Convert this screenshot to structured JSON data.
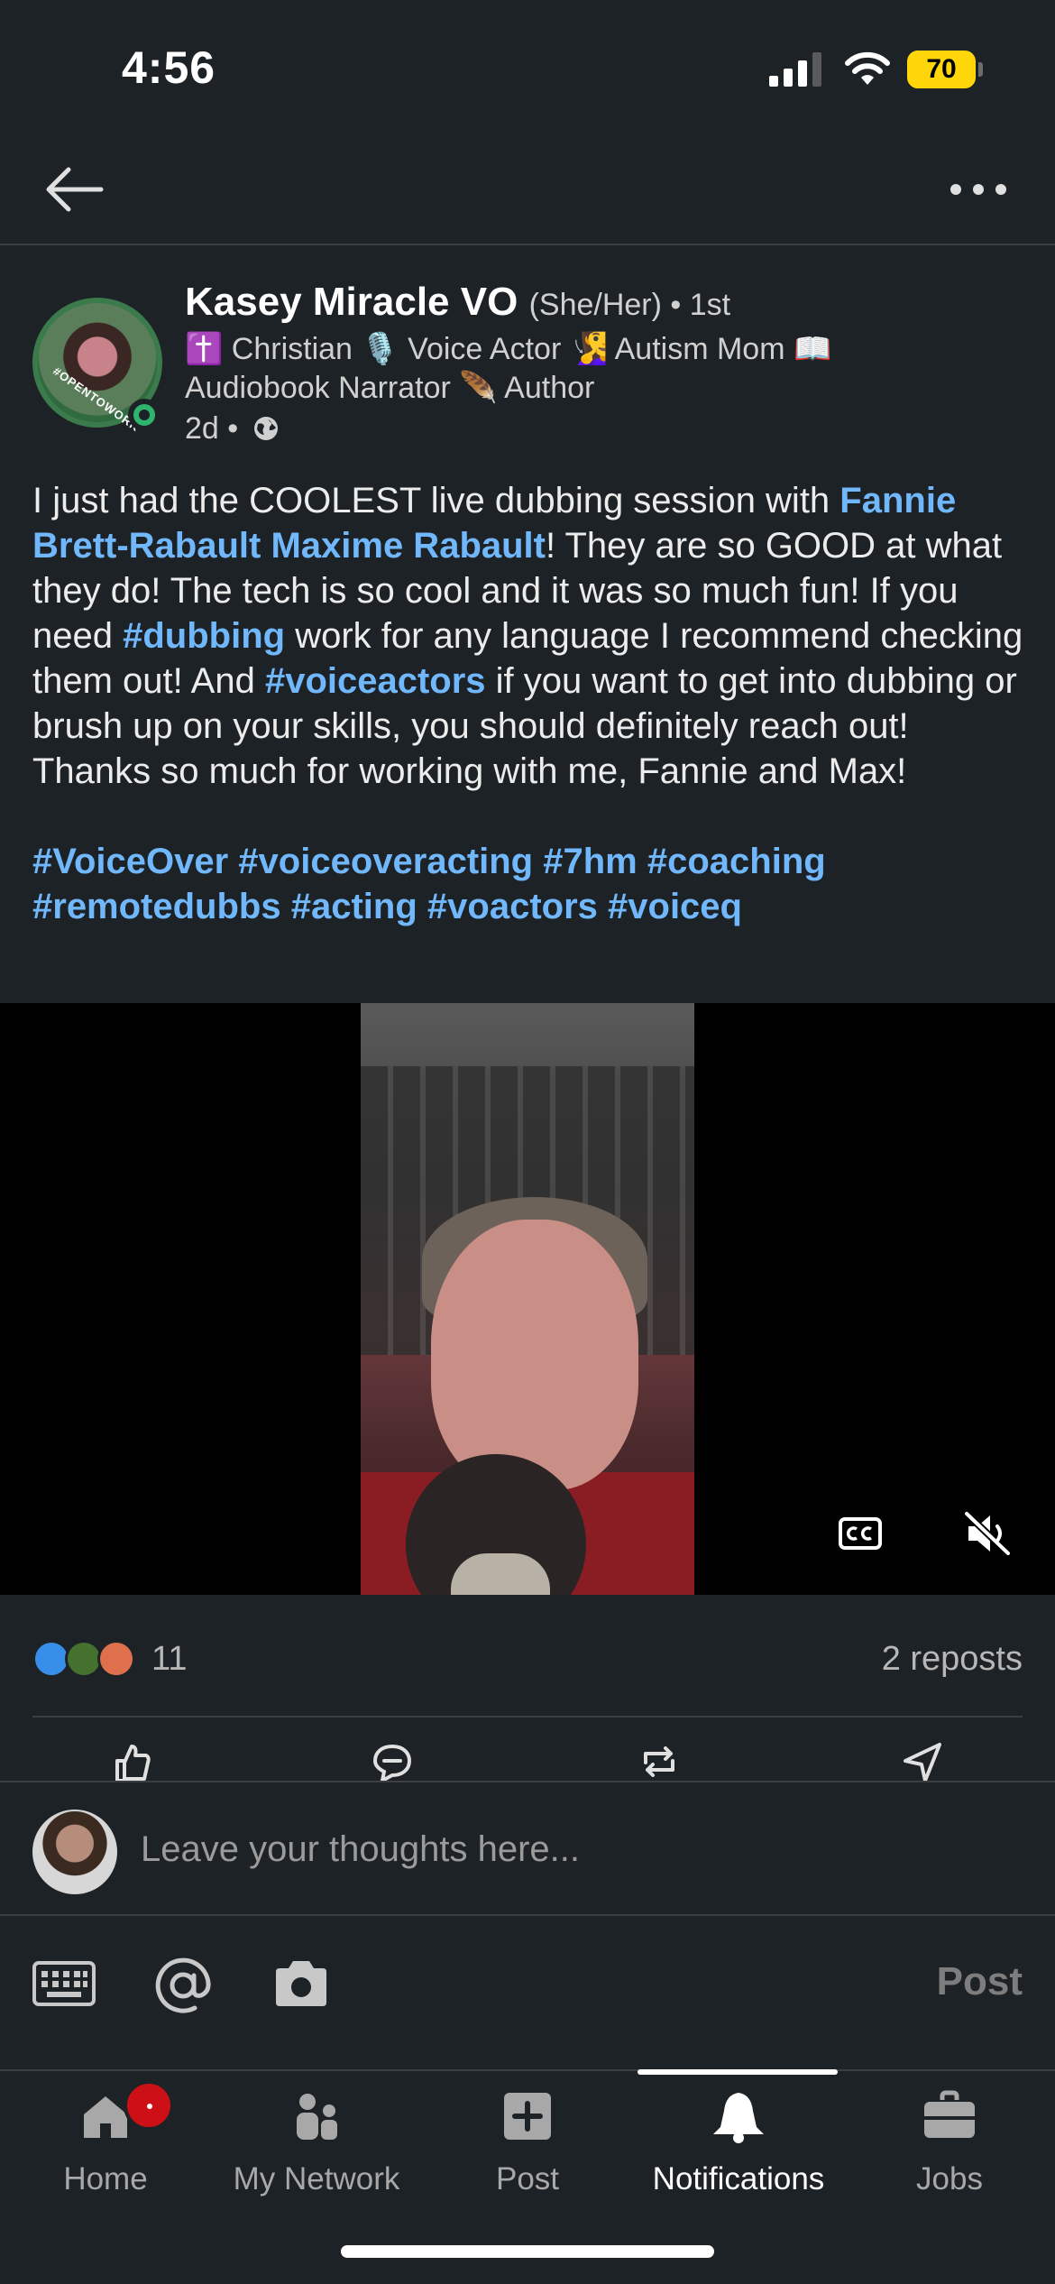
{
  "status_bar": {
    "time": "4:56",
    "battery": "70"
  },
  "post": {
    "author_name": "Kasey Miracle VO",
    "pronouns": "(She/Her)",
    "degree": " • 1st",
    "headline": "✝️ Christian 🎙️ Voice Actor 🧏‍♀️ Autism Mom 📖 Audiobook Narrator 🪶 Author",
    "avatar_frame_text": "#OPENTOWORK",
    "time_ago": "2d •",
    "body": {
      "p1": "I just had the COOLEST live dubbing session with ",
      "mention": "Fannie Brett-Rabault Maxime Rabault",
      "p2": "! They are so GOOD at what they do! The tech is so cool and it was so much fun! If you need ",
      "tag1": "#dubbing",
      "p3": " work for any language I recommend checking them out! And ",
      "tag2": "#voiceactors",
      "p4": " if you want to get into dubbing or brush up on your skills, you should definitely reach out! Thanks so much for working with me, Fannie and Max!"
    },
    "hashtags": [
      "#VoiceOver",
      "#voiceoveracting",
      "#7hm",
      "#coaching",
      "#remotedubbs",
      "#acting",
      "#voactors",
      "#voiceq"
    ],
    "reaction_count": "11",
    "reposts": "2 reposts",
    "reaction_icons": [
      "like-icon",
      "celebrate-icon",
      "love-icon"
    ]
  },
  "comment": {
    "placeholder": "Leave your thoughts here...",
    "post_label": "Post"
  },
  "tabs": [
    {
      "label": "Home",
      "icon": "home-icon"
    },
    {
      "label": "My Network",
      "icon": "network-icon"
    },
    {
      "label": "Post",
      "icon": "plus-icon"
    },
    {
      "label": "Notifications",
      "icon": "bell-icon"
    },
    {
      "label": "Jobs",
      "icon": "briefcase-icon"
    }
  ],
  "colors": {
    "background": "#1d2226",
    "link": "#71b7fb",
    "badge": "#cc1016",
    "battery": "#ffd60a"
  }
}
